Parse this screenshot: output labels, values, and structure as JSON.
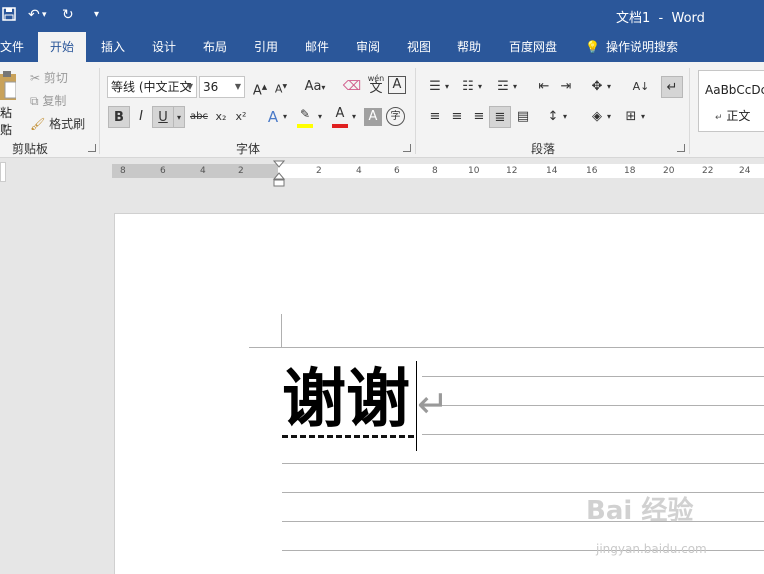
{
  "title_bar": {
    "document": "文档1",
    "separator": "-",
    "app": "Word",
    "customize": "▾"
  },
  "tabs": [
    {
      "label": "文件"
    },
    {
      "label": "开始"
    },
    {
      "label": "插入"
    },
    {
      "label": "设计"
    },
    {
      "label": "布局"
    },
    {
      "label": "引用"
    },
    {
      "label": "邮件"
    },
    {
      "label": "审阅"
    },
    {
      "label": "视图"
    },
    {
      "label": "帮助"
    },
    {
      "label": "百度网盘"
    },
    {
      "label": "操作说明搜索"
    }
  ],
  "active_tab": "开始",
  "clipboard": {
    "paste_label": "粘贴",
    "cut_label": "剪切",
    "copy_label": "复制",
    "format_painter_label": "格式刷",
    "group_label": "剪贴板"
  },
  "font": {
    "font_name": "等线 (中文正文",
    "font_size": "36",
    "change_case": "Aa",
    "phonetic": "wén",
    "group_label": "字体",
    "bold": "B",
    "italic": "I",
    "underline": "U",
    "strike": "abc",
    "subscript": "x₂",
    "superscript": "x²",
    "char_border": "A",
    "char_shading": "A",
    "enclose": "字"
  },
  "paragraph": {
    "group_label": "段落"
  },
  "styles": {
    "preview": "AaBbCcDc",
    "normal": "正文"
  },
  "ruler": {
    "numbers": [
      "8",
      "6",
      "4",
      "2",
      "2",
      "4",
      "6",
      "8",
      "10",
      "12",
      "14",
      "16",
      "18",
      "20",
      "22",
      "24"
    ]
  },
  "document": {
    "text": "谢谢",
    "paragraph_mark": "↵"
  },
  "watermark": {
    "main": "Bai 经验",
    "sub": "jingyan.baidu.com"
  },
  "colors": {
    "accent": "#2b579a",
    "ribbon_bg": "#f3f3f3",
    "font_color": "#e02020",
    "highlight": "#ffff00"
  }
}
